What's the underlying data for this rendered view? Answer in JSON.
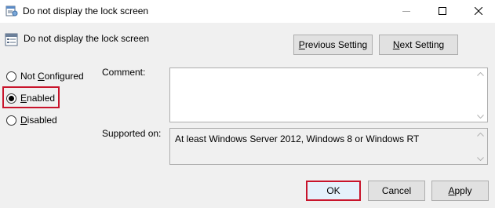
{
  "window": {
    "title": "Do not display the lock screen",
    "controls": [
      "minimize",
      "maximize",
      "close"
    ]
  },
  "header": {
    "policy_name": "Do not display the lock screen",
    "icon": "policy-setting-icon"
  },
  "nav": {
    "previous": {
      "underlined": "P",
      "rest": "revious Setting"
    },
    "next": {
      "underlined": "N",
      "rest": "ext Setting"
    }
  },
  "options": {
    "not_configured": {
      "underlined": "C",
      "before": "Not ",
      "after": "onfigured",
      "selected": false
    },
    "enabled": {
      "underlined": "E",
      "rest": "nabled",
      "selected": true
    },
    "disabled": {
      "underlined": "D",
      "rest": "isabled",
      "selected": false
    }
  },
  "comment": {
    "label": "Comment:",
    "value": ""
  },
  "supported": {
    "label": "Supported on:",
    "value": "At least Windows Server 2012, Windows 8 or Windows RT"
  },
  "footer": {
    "ok": "OK",
    "cancel": "Cancel",
    "apply": {
      "underlined": "A",
      "rest": "pply"
    }
  },
  "colors": {
    "highlight": "#c8142b",
    "client_bg": "#f0f0f0"
  }
}
